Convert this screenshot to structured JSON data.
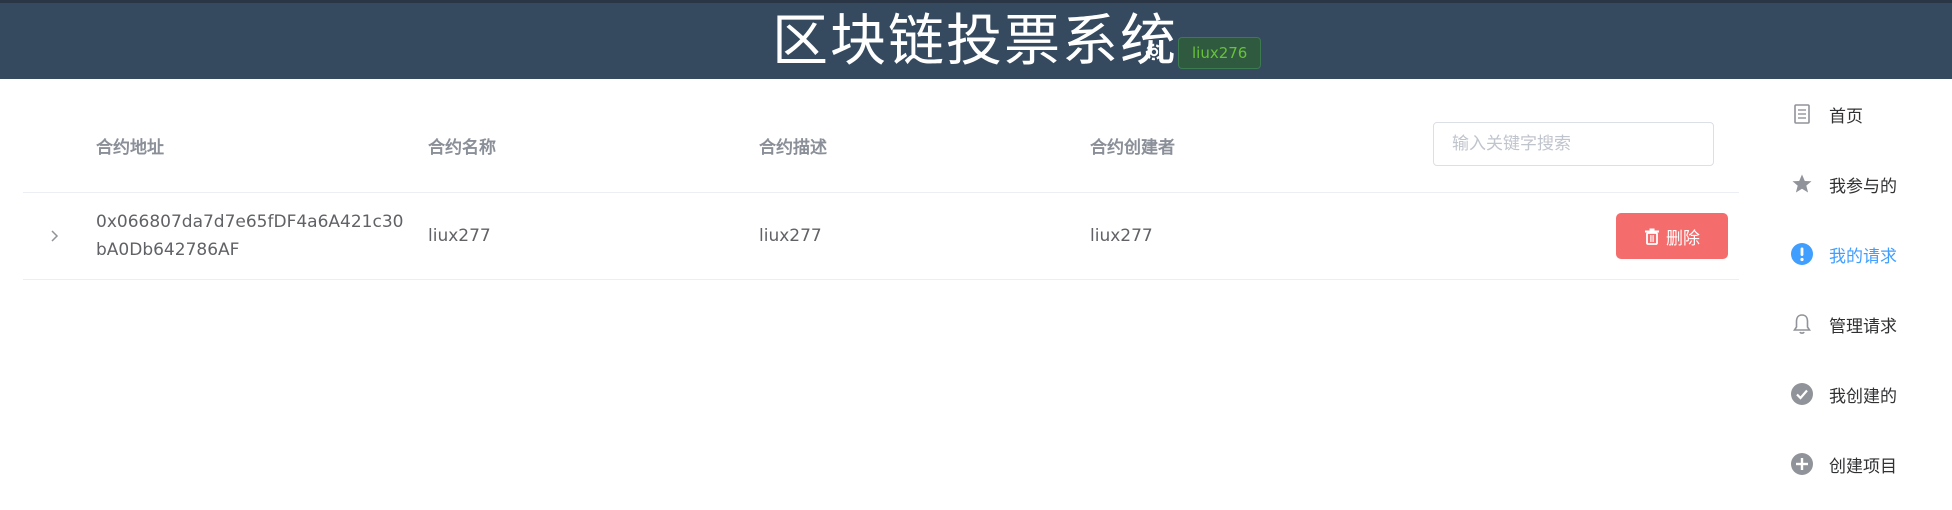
{
  "header": {
    "title": "区块链投票系统",
    "user": "liux276",
    "icon": "gear-icon"
  },
  "table": {
    "columns": [
      "合约地址",
      "合约名称",
      "合约描述",
      "合约创建者"
    ],
    "search_placeholder": "输入关键字搜索",
    "rows": [
      {
        "address": "0x066807da7d7e65fDF4a6A421c30bA0Db642786AF",
        "name": "liux277",
        "description": "liux277",
        "creator": "liux277",
        "delete_label": "删除"
      }
    ]
  },
  "sidebar": {
    "items": [
      {
        "label": "首页",
        "icon": "document-icon",
        "active": false
      },
      {
        "label": "我参与的",
        "icon": "star-icon",
        "active": false
      },
      {
        "label": "我的请求",
        "icon": "warning-icon",
        "active": true
      },
      {
        "label": "管理请求",
        "icon": "bell-icon",
        "active": false
      },
      {
        "label": "我创建的",
        "icon": "check-circle-icon",
        "active": false
      },
      {
        "label": "创建项目",
        "icon": "plus-circle-icon",
        "active": false
      }
    ]
  },
  "colors": {
    "header_bg": "#354a5f",
    "accent": "#409eff",
    "danger": "#f56c6c",
    "success": "#67c23a"
  }
}
